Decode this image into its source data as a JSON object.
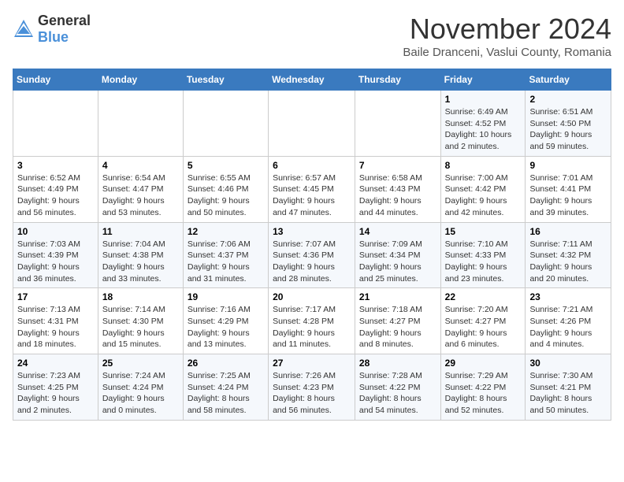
{
  "logo": {
    "general": "General",
    "blue": "Blue"
  },
  "title": "November 2024",
  "location": "Baile Dranceni, Vaslui County, Romania",
  "days_of_week": [
    "Sunday",
    "Monday",
    "Tuesday",
    "Wednesday",
    "Thursday",
    "Friday",
    "Saturday"
  ],
  "weeks": [
    [
      {
        "day": "",
        "info": ""
      },
      {
        "day": "",
        "info": ""
      },
      {
        "day": "",
        "info": ""
      },
      {
        "day": "",
        "info": ""
      },
      {
        "day": "",
        "info": ""
      },
      {
        "day": "1",
        "info": "Sunrise: 6:49 AM\nSunset: 4:52 PM\nDaylight: 10 hours and 2 minutes."
      },
      {
        "day": "2",
        "info": "Sunrise: 6:51 AM\nSunset: 4:50 PM\nDaylight: 9 hours and 59 minutes."
      }
    ],
    [
      {
        "day": "3",
        "info": "Sunrise: 6:52 AM\nSunset: 4:49 PM\nDaylight: 9 hours and 56 minutes."
      },
      {
        "day": "4",
        "info": "Sunrise: 6:54 AM\nSunset: 4:47 PM\nDaylight: 9 hours and 53 minutes."
      },
      {
        "day": "5",
        "info": "Sunrise: 6:55 AM\nSunset: 4:46 PM\nDaylight: 9 hours and 50 minutes."
      },
      {
        "day": "6",
        "info": "Sunrise: 6:57 AM\nSunset: 4:45 PM\nDaylight: 9 hours and 47 minutes."
      },
      {
        "day": "7",
        "info": "Sunrise: 6:58 AM\nSunset: 4:43 PM\nDaylight: 9 hours and 44 minutes."
      },
      {
        "day": "8",
        "info": "Sunrise: 7:00 AM\nSunset: 4:42 PM\nDaylight: 9 hours and 42 minutes."
      },
      {
        "day": "9",
        "info": "Sunrise: 7:01 AM\nSunset: 4:41 PM\nDaylight: 9 hours and 39 minutes."
      }
    ],
    [
      {
        "day": "10",
        "info": "Sunrise: 7:03 AM\nSunset: 4:39 PM\nDaylight: 9 hours and 36 minutes."
      },
      {
        "day": "11",
        "info": "Sunrise: 7:04 AM\nSunset: 4:38 PM\nDaylight: 9 hours and 33 minutes."
      },
      {
        "day": "12",
        "info": "Sunrise: 7:06 AM\nSunset: 4:37 PM\nDaylight: 9 hours and 31 minutes."
      },
      {
        "day": "13",
        "info": "Sunrise: 7:07 AM\nSunset: 4:36 PM\nDaylight: 9 hours and 28 minutes."
      },
      {
        "day": "14",
        "info": "Sunrise: 7:09 AM\nSunset: 4:34 PM\nDaylight: 9 hours and 25 minutes."
      },
      {
        "day": "15",
        "info": "Sunrise: 7:10 AM\nSunset: 4:33 PM\nDaylight: 9 hours and 23 minutes."
      },
      {
        "day": "16",
        "info": "Sunrise: 7:11 AM\nSunset: 4:32 PM\nDaylight: 9 hours and 20 minutes."
      }
    ],
    [
      {
        "day": "17",
        "info": "Sunrise: 7:13 AM\nSunset: 4:31 PM\nDaylight: 9 hours and 18 minutes."
      },
      {
        "day": "18",
        "info": "Sunrise: 7:14 AM\nSunset: 4:30 PM\nDaylight: 9 hours and 15 minutes."
      },
      {
        "day": "19",
        "info": "Sunrise: 7:16 AM\nSunset: 4:29 PM\nDaylight: 9 hours and 13 minutes."
      },
      {
        "day": "20",
        "info": "Sunrise: 7:17 AM\nSunset: 4:28 PM\nDaylight: 9 hours and 11 minutes."
      },
      {
        "day": "21",
        "info": "Sunrise: 7:18 AM\nSunset: 4:27 PM\nDaylight: 9 hours and 8 minutes."
      },
      {
        "day": "22",
        "info": "Sunrise: 7:20 AM\nSunset: 4:27 PM\nDaylight: 9 hours and 6 minutes."
      },
      {
        "day": "23",
        "info": "Sunrise: 7:21 AM\nSunset: 4:26 PM\nDaylight: 9 hours and 4 minutes."
      }
    ],
    [
      {
        "day": "24",
        "info": "Sunrise: 7:23 AM\nSunset: 4:25 PM\nDaylight: 9 hours and 2 minutes."
      },
      {
        "day": "25",
        "info": "Sunrise: 7:24 AM\nSunset: 4:24 PM\nDaylight: 9 hours and 0 minutes."
      },
      {
        "day": "26",
        "info": "Sunrise: 7:25 AM\nSunset: 4:24 PM\nDaylight: 8 hours and 58 minutes."
      },
      {
        "day": "27",
        "info": "Sunrise: 7:26 AM\nSunset: 4:23 PM\nDaylight: 8 hours and 56 minutes."
      },
      {
        "day": "28",
        "info": "Sunrise: 7:28 AM\nSunset: 4:22 PM\nDaylight: 8 hours and 54 minutes."
      },
      {
        "day": "29",
        "info": "Sunrise: 7:29 AM\nSunset: 4:22 PM\nDaylight: 8 hours and 52 minutes."
      },
      {
        "day": "30",
        "info": "Sunrise: 7:30 AM\nSunset: 4:21 PM\nDaylight: 8 hours and 50 minutes."
      }
    ]
  ]
}
